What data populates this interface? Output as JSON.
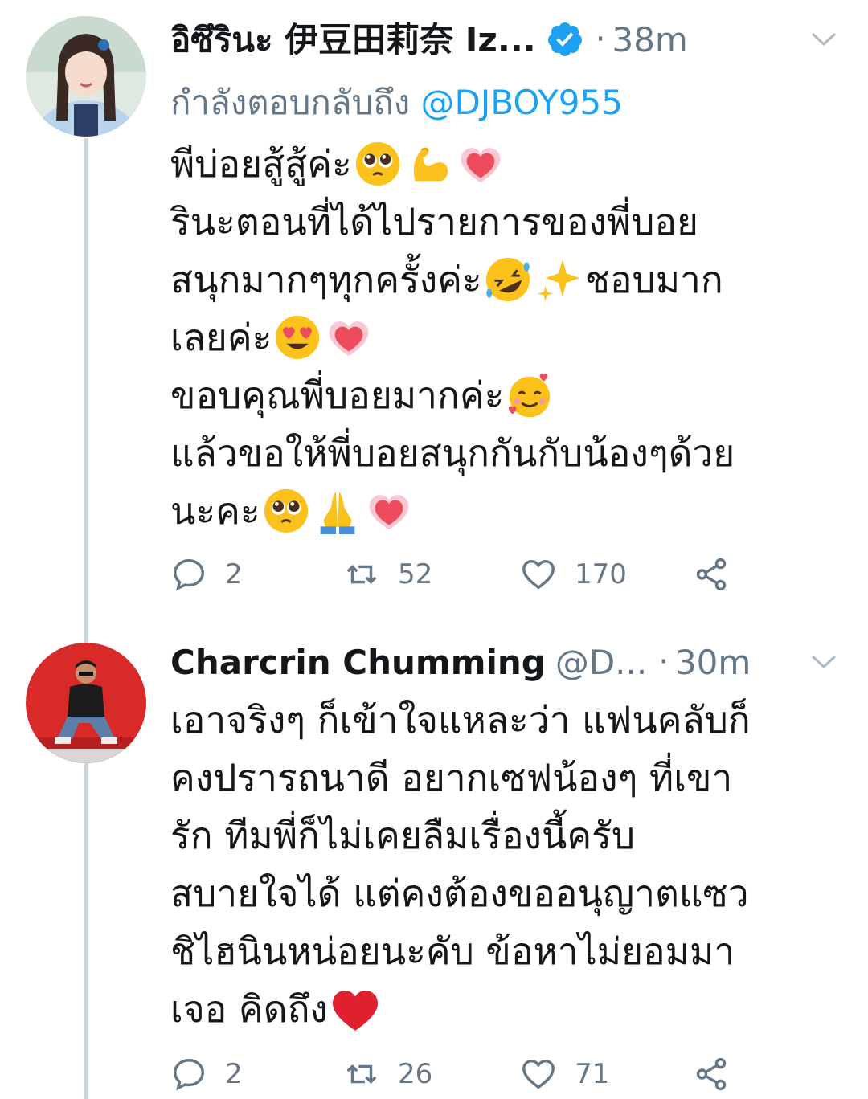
{
  "tweets": [
    {
      "name": "อิซึรินะ 伊豆田莉奈 Iz...",
      "verified": true,
      "time": "38m",
      "reply_prefix": "กำลังตอบกลับถึง",
      "reply_mention": "@DJBOY955",
      "lines": [
        {
          "text": "พีบ่อยสู้สู้ค่ะ",
          "emojis": [
            "pleading-face",
            "flexed-biceps",
            "growing-heart"
          ]
        },
        {
          "text": "รินะตอนที่ได้ไปรายการของพี่บอย",
          "emojis": []
        },
        {
          "text": "สนุกมากๆทุกครั้งค่ะ",
          "emojis": [
            "rofl-face",
            "sparkles"
          ],
          "after": "ชอบมาก"
        },
        {
          "text": "เลยค่ะ",
          "emojis": [
            "heart-eyes-face",
            "growing-heart"
          ]
        },
        {
          "text": "ขอบคุณพี่บอยมากค่ะ",
          "emojis": [
            "smiling-face-with-hearts"
          ]
        },
        {
          "text": "แล้วขอให้พี่บอยสนุกกันกับน้องๆด้วย",
          "emojis": []
        },
        {
          "text": "นะคะ",
          "emojis": [
            "pleading-face",
            "folded-hands",
            "growing-heart"
          ]
        }
      ],
      "replies": "2",
      "retweets": "52",
      "likes": "170"
    },
    {
      "name": "Charcrin Chumming",
      "handle": "@D...",
      "time": "30m",
      "lines": [
        {
          "text": "เอาจริงๆ ก็เข้าใจแหละว่า แฟนคลับก็",
          "emojis": []
        },
        {
          "text": "คงปรารถนาดี อยากเซฟน้องๆ ที่เขา",
          "emojis": []
        },
        {
          "text": "รัก  ทีมพี่ก็ไม่เคยลืมเรื่องนี้ครับ",
          "emojis": []
        },
        {
          "text": "สบายใจได้ แต่คงต้องขออนุญาตแซว",
          "emojis": []
        },
        {
          "text": "ชิไฮนินหน่อยนะคับ ข้อหาไม่ยอมมา",
          "emojis": []
        },
        {
          "text": "เจอ คิดถึง",
          "emojis": [
            "red-heart"
          ]
        }
      ],
      "replies": "2",
      "retweets": "26",
      "likes": "71"
    }
  ],
  "icons": {
    "reply": "reply-icon",
    "retweet": "retweet-icon",
    "like": "like-icon",
    "share": "share-icon",
    "verified": "verified-badge-icon",
    "chevron": "chevron-down-icon"
  },
  "colors": {
    "text": "#14171a",
    "secondary": "#657786",
    "link": "#1da1f2",
    "thread_line": "#ccd6dd"
  }
}
